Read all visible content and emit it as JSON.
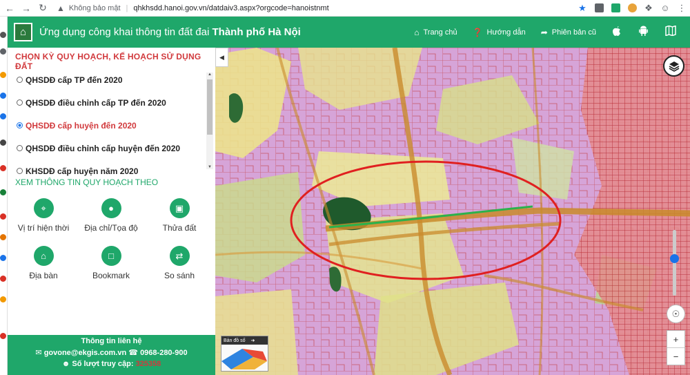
{
  "browser": {
    "security_label": "Không bảo mật",
    "url": "qhkhsdd.hanoi.gov.vn/datdaiv3.aspx?orgcode=hanoistnmt"
  },
  "header": {
    "title_prefix": "Ứng dụng công khai thông tin đất đai",
    "title_city": "Thành phố Hà Nội",
    "nav": {
      "home": "Trang chủ",
      "guide": "Hướng dẫn",
      "old_version": "Phiên bản cũ"
    }
  },
  "sidebar": {
    "plan_heading": "CHỌN KỲ QUY HOẠCH, KẾ HOẠCH SỬ DỤNG ĐẤT",
    "plans": [
      {
        "label": "QHSDĐ cấp TP đến 2020",
        "selected": false
      },
      {
        "label": "QHSDĐ điều chỉnh cấp TP đến 2020",
        "selected": false
      },
      {
        "label": "QHSDĐ cấp huyện đến 2020",
        "selected": true
      },
      {
        "label": "QHSDĐ điều chỉnh cấp huyện đến 2020",
        "selected": false
      },
      {
        "label": "KHSDĐ cấp huyện năm 2020",
        "selected": false
      }
    ],
    "view_heading": "XEM THÔNG TIN QUY HOẠCH THEO",
    "tools": [
      {
        "label": "Vị trí hiện thời",
        "icon": "crosshair-icon"
      },
      {
        "label": "Địa chỉ/Tọa độ",
        "icon": "map-pin-icon"
      },
      {
        "label": "Thửa đất",
        "icon": "cube-icon"
      },
      {
        "label": "Địa bàn",
        "icon": "building-icon"
      },
      {
        "label": "Bookmark",
        "icon": "bookmark-icon"
      },
      {
        "label": "So sánh",
        "icon": "swap-icon"
      }
    ],
    "footer": {
      "heading": "Thông tin liên hệ",
      "email": "govone@ekgis.com.vn",
      "phone": "0968-280-900",
      "visits_label": "Số lượt truy cập:",
      "visits_count": "325358"
    }
  },
  "map": {
    "basemap_label": "Bản đồ số",
    "zoom_in": "+",
    "zoom_out": "−",
    "highlight_color": "#e02020",
    "route_color": "#2bb24c",
    "zoom_level_fraction": 0.43
  }
}
